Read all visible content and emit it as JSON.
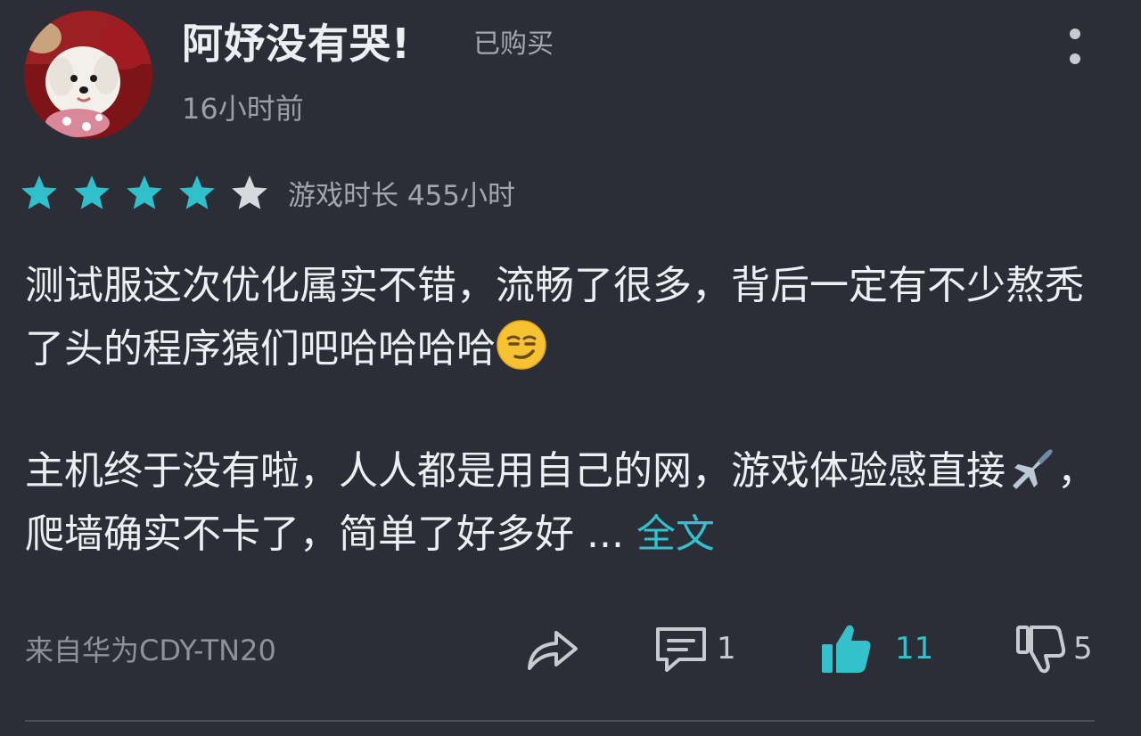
{
  "review": {
    "username": "阿妤没有哭!",
    "purchased_badge": "已购买",
    "time_ago": "16小时前",
    "rating": {
      "value": 4,
      "max": 5,
      "filled_color": "#2fc0cb",
      "empty_color": "#d8d9dc"
    },
    "playtime": "游戏时长 455小时",
    "paragraph_1": "测试服这次优化属实不错，流畅了很多，背后一定有不少熬秃了头的程序猿们吧哈哈哈哈",
    "paragraph_1_emoji": "smirk-emoji",
    "paragraph_2_part1": "主机终于没有啦，人人都是用自己的网，游戏体验感直接",
    "paragraph_2_emoji": "airplane-emoji",
    "paragraph_2_part2": "，爬墙确实不卡了，简单了好多好 ... ",
    "expand_label": "全文",
    "device": "来自华为CDY-TN20",
    "actions": {
      "comment_count": "1",
      "like_count": "11",
      "dislike_count": "5"
    },
    "accent_color": "#33c1cc",
    "background_color": "#2b2e36"
  }
}
